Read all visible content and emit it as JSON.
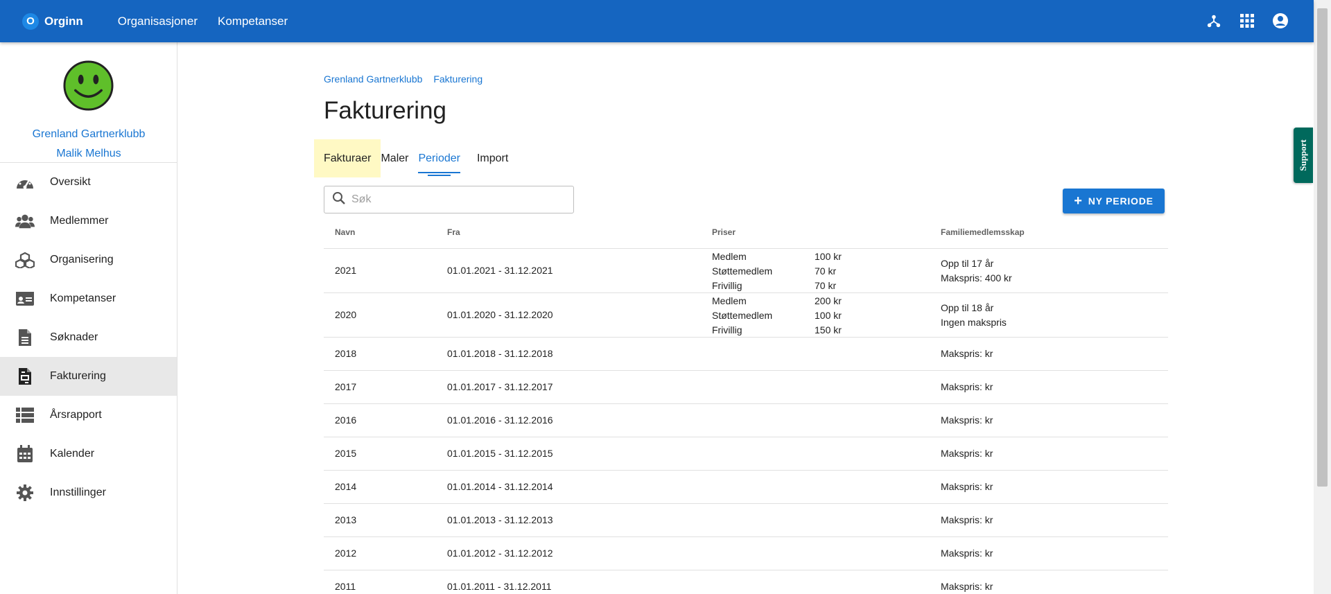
{
  "topbar": {
    "brand_letter": "O",
    "brand_name": "Orginn",
    "nav": [
      "Organisasjoner",
      "Kompetanser"
    ],
    "icons": [
      "hierarchy-icon",
      "apps-grid-icon",
      "account-circle-icon"
    ]
  },
  "sidebar": {
    "org_name": "Grenland Gartnerklubb",
    "user_name": "Malik Melhus",
    "items": [
      {
        "label": "Oversikt",
        "icon": "speedometer-icon"
      },
      {
        "label": "Medlemmer",
        "icon": "users-icon"
      },
      {
        "label": "Organisering",
        "icon": "cubes-icon"
      },
      {
        "label": "Kompetanser",
        "icon": "id-card-icon"
      },
      {
        "label": "Søknader",
        "icon": "document-icon"
      },
      {
        "label": "Fakturering",
        "icon": "invoice-icon",
        "active": true
      },
      {
        "label": "Årsrapport",
        "icon": "list-icon"
      },
      {
        "label": "Kalender",
        "icon": "calendar-icon"
      },
      {
        "label": "Innstillinger",
        "icon": "gear-icon"
      }
    ]
  },
  "breadcrumb": [
    "Grenland Gartnerklubb",
    "Fakturering"
  ],
  "page_title": "Fakturering",
  "tabs": [
    {
      "label": "Fakturaer",
      "highlighted": true
    },
    {
      "label": "Maler"
    },
    {
      "label": "Perioder",
      "selected": true
    },
    {
      "label": "Import"
    }
  ],
  "search": {
    "placeholder": "Søk",
    "value": ""
  },
  "new_button_label": "NY PERIODE",
  "support_label": "Support",
  "table": {
    "headers": {
      "navn": "Navn",
      "fra": "Fra",
      "priser": "Priser",
      "familie": "Familiemedlemsskap"
    },
    "rows": [
      {
        "navn": "2021",
        "fra": "01.01.2021 - 31.12.2021",
        "priser": [
          {
            "name": "Medlem",
            "price": "100 kr"
          },
          {
            "name": "Støttemedlem",
            "price": "70 kr"
          },
          {
            "name": "Frivillig",
            "price": "70 kr"
          }
        ],
        "familie": [
          "Opp til 17 år",
          "Makspris: 400 kr"
        ]
      },
      {
        "navn": "2020",
        "fra": "01.01.2020 - 31.12.2020",
        "priser": [
          {
            "name": "Medlem",
            "price": "200 kr"
          },
          {
            "name": "Støttemedlem",
            "price": "100 kr"
          },
          {
            "name": "Frivillig",
            "price": "150 kr"
          }
        ],
        "familie": [
          "Opp til 18 år",
          "Ingen makspris"
        ]
      },
      {
        "navn": "2018",
        "fra": "01.01.2018 - 31.12.2018",
        "priser": [],
        "familie": [
          "Makspris: kr"
        ]
      },
      {
        "navn": "2017",
        "fra": "01.01.2017 - 31.12.2017",
        "priser": [],
        "familie": [
          "Makspris: kr"
        ]
      },
      {
        "navn": "2016",
        "fra": "01.01.2016 - 31.12.2016",
        "priser": [],
        "familie": [
          "Makspris: kr"
        ]
      },
      {
        "navn": "2015",
        "fra": "01.01.2015 - 31.12.2015",
        "priser": [],
        "familie": [
          "Makspris: kr"
        ]
      },
      {
        "navn": "2014",
        "fra": "01.01.2014 - 31.12.2014",
        "priser": [],
        "familie": [
          "Makspris: kr"
        ]
      },
      {
        "navn": "2013",
        "fra": "01.01.2013 - 31.12.2013",
        "priser": [],
        "familie": [
          "Makspris: kr"
        ]
      },
      {
        "navn": "2012",
        "fra": "01.01.2012 - 31.12.2012",
        "priser": [],
        "familie": [
          "Makspris: kr"
        ]
      },
      {
        "navn": "2011",
        "fra": "01.01.2011 - 31.12.2011",
        "priser": [],
        "familie": [
          "Makspris: kr"
        ]
      }
    ]
  },
  "colors": {
    "primary": "#1565c0",
    "accent": "#1976d2",
    "support": "#00695c",
    "highlight": "#fff9c4",
    "smiley": "#5fbf2a"
  }
}
